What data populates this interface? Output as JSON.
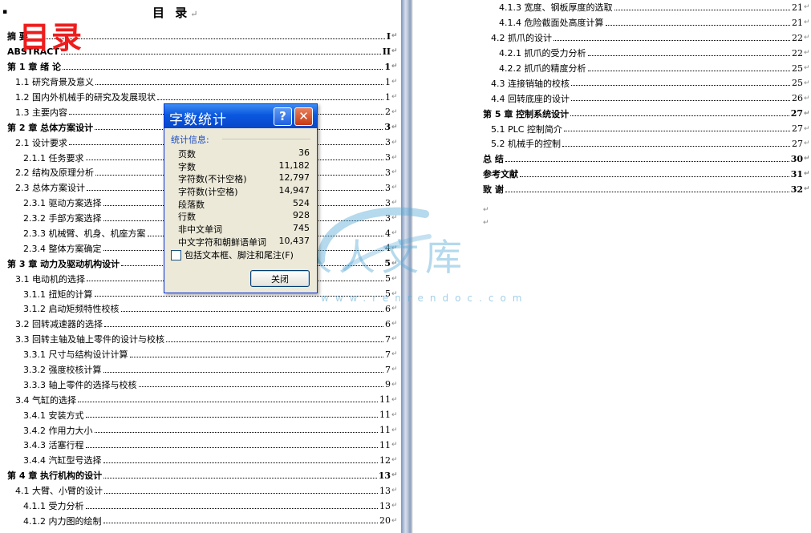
{
  "left_page": {
    "title": "目 录",
    "title_mark": "↵",
    "bullet": "▪",
    "stamp": "目录",
    "entries": [
      {
        "text": "摘 要",
        "page": "I",
        "level": 1
      },
      {
        "text": "ABSTRACT",
        "page": "II",
        "level": 1
      },
      {
        "text": "第 1 章 绪 论",
        "page": "1",
        "level": 1
      },
      {
        "text": "1.1 研究背景及意义",
        "page": "1",
        "level": 2
      },
      {
        "text": "1.2 国内外机械手的研究及发展现状",
        "page": "1",
        "level": 2
      },
      {
        "text": "1.3 主要内容",
        "page": "2",
        "level": 2
      },
      {
        "text": "第 2 章 总体方案设计",
        "page": "3",
        "level": 1
      },
      {
        "text": "2.1 设计要求",
        "page": "3",
        "level": 2
      },
      {
        "text": "2.1.1 任务要求",
        "page": "3",
        "level": 3
      },
      {
        "text": "2.2 结构及原理分析",
        "page": "3",
        "level": 2
      },
      {
        "text": "2.3 总体方案设计",
        "page": "3",
        "level": 2
      },
      {
        "text": "2.3.1 驱动方案选择",
        "page": "3",
        "level": 3
      },
      {
        "text": "2.3.2 手部方案选择",
        "page": "3",
        "level": 3
      },
      {
        "text": "2.3.3 机械臂、机身、机座方案",
        "page": "4",
        "level": 3
      },
      {
        "text": "2.3.4 整体方案确定",
        "page": "4",
        "level": 3
      },
      {
        "text": "第 3 章 动力及驱动机构设计",
        "page": "5",
        "level": 1
      },
      {
        "text": "3.1 电动机的选择",
        "page": "5",
        "level": 2
      },
      {
        "text": "3.1.1 扭矩的计算",
        "page": "5",
        "level": 3
      },
      {
        "text": "3.1.2 启动矩频特性校核",
        "page": "6",
        "level": 3
      },
      {
        "text": "3.2 回转减速器的选择",
        "page": "6",
        "level": 2
      },
      {
        "text": "3.3 回转主轴及轴上零件的设计与校核",
        "page": "7",
        "level": 2
      },
      {
        "text": "3.3.1 尺寸与结构设计计算",
        "page": "7",
        "level": 3
      },
      {
        "text": "3.3.2 强度校核计算",
        "page": "7",
        "level": 3
      },
      {
        "text": "3.3.3 轴上零件的选择与校核",
        "page": "9",
        "level": 3
      },
      {
        "text": "3.4 气缸的选择",
        "page": "11",
        "level": 2
      },
      {
        "text": "3.4.1 安装方式",
        "page": "11",
        "level": 3
      },
      {
        "text": "3.4.2 作用力大小",
        "page": "11",
        "level": 3
      },
      {
        "text": "3.4.3 活塞行程",
        "page": "11",
        "level": 3
      },
      {
        "text": "3.4.4 汽缸型号选择",
        "page": "12",
        "level": 3
      },
      {
        "text": "第 4 章 执行机构的设计",
        "page": "13",
        "level": 1
      },
      {
        "text": "4.1 大臂、小臂的设计",
        "page": "13",
        "level": 2
      },
      {
        "text": "4.1.1 受力分析",
        "page": "13",
        "level": 3
      },
      {
        "text": "4.1.2 内力图的绘制",
        "page": "20",
        "level": 3
      }
    ]
  },
  "right_page": {
    "entries": [
      {
        "text": "4.1.3 宽度、钢板厚度的选取",
        "page": "21",
        "level": 3
      },
      {
        "text": "4.1.4 危险截面处高度计算",
        "page": "21",
        "level": 3
      },
      {
        "text": "4.2 抓爪的设计",
        "page": "22",
        "level": 2
      },
      {
        "text": "4.2.1 抓爪的受力分析",
        "page": "22",
        "level": 3
      },
      {
        "text": "4.2.2 抓爪的精度分析",
        "page": "25",
        "level": 3
      },
      {
        "text": "4.3 连接销轴的校核",
        "page": "25",
        "level": 2
      },
      {
        "text": "4.4 回转底座的设计",
        "page": "26",
        "level": 2
      },
      {
        "text": "第 5 章 控制系统设计",
        "page": "27",
        "level": 1
      },
      {
        "text": "5.1 PLC 控制简介",
        "page": "27",
        "level": 2
      },
      {
        "text": "5.2 机械手的控制",
        "page": "27",
        "level": 2
      },
      {
        "text": "总 结",
        "page": "30",
        "level": 1
      },
      {
        "text": "参考文献",
        "page": "31",
        "level": 1
      },
      {
        "text": "致 谢",
        "page": "32",
        "level": 1
      }
    ],
    "trailing_marks": [
      "↵",
      "↵"
    ]
  },
  "row_mark": "↵",
  "watermark": {
    "text": "人人文库",
    "url": "www.renrendoc.com"
  },
  "dialog": {
    "title": "字数统计",
    "help_label": "?",
    "close_x": "✕",
    "group_label": "统计信息:",
    "stats": [
      {
        "label": "页数",
        "value": "36"
      },
      {
        "label": "字数",
        "value": "11,182"
      },
      {
        "label": "字符数(不计空格)",
        "value": "12,797"
      },
      {
        "label": "字符数(计空格)",
        "value": "14,947"
      },
      {
        "label": "段落数",
        "value": "524"
      },
      {
        "label": "行数",
        "value": "928"
      },
      {
        "label": "非中文单词",
        "value": "745"
      },
      {
        "label": "中文字符和朝鲜语单词",
        "value": "10,437"
      }
    ],
    "checkbox_label": "包括文本框、脚注和尾注(F)",
    "checkbox_checked": false,
    "close_button": "关闭"
  }
}
